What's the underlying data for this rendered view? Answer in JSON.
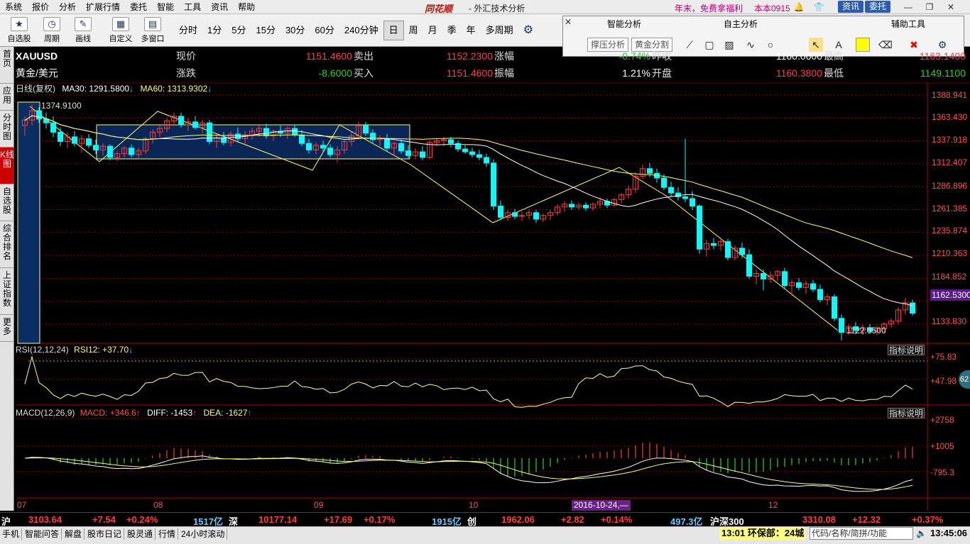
{
  "menu": {
    "items": [
      "系统",
      "报价",
      "分析",
      "扩展行情",
      "委托",
      "智能",
      "工具",
      "资讯",
      "帮助"
    ],
    "brand": "同花顺",
    "app_title": "- 外汇技术分析",
    "promo": "年末，免费拿福利",
    "version": "本本0915",
    "info_button": "资讯",
    "trade_button": "委托"
  },
  "toolbar": {
    "tools": [
      {
        "label": "自选股",
        "icon": "star-icon"
      },
      {
        "label": "周期",
        "icon": "cycle-icon"
      },
      {
        "label": "画线",
        "icon": "pen-icon"
      },
      {
        "label": "自定义",
        "icon": "custom-icon"
      },
      {
        "label": "多窗口",
        "icon": "multiwindow-icon"
      }
    ],
    "periods": [
      "分时",
      "1分",
      "5分",
      "15分",
      "30分",
      "60分",
      "240分钟",
      "日",
      "周",
      "月",
      "季",
      "年",
      "多周期"
    ],
    "active_period": "日"
  },
  "analysis_panel": {
    "smart": "智能分析",
    "self": "自主分析",
    "aux": "辅助工具",
    "btn_pressure": "撑压分析",
    "btn_golden": "黄金分割"
  },
  "vertical_tabs": [
    "首页",
    "应用",
    "分时图",
    "K线图",
    "自选股",
    "综合排名",
    "上证指数",
    "更多"
  ],
  "active_tab": "K线图",
  "quote": {
    "symbol": "XAUUSD",
    "name": "黄金/美元",
    "l_now": "现价",
    "v_now": "1151.4600",
    "l_chg": "涨跌",
    "v_chg": "-8.6000",
    "l_sell": "卖出",
    "v_sell": "1152.2300",
    "l_buy": "买入",
    "v_buy": "1151.4600",
    "l_pct": "涨幅",
    "v_pct": "-0.74%",
    "l_amp": "振幅",
    "v_amp": "1.21%",
    "l_prev": "昨收",
    "v_prev": "1160.0600",
    "l_open": "开盘",
    "v_open": "1160.3800",
    "l_high": "最高",
    "v_high": "1163.1400",
    "l_low": "最低",
    "v_low": "1149.1100"
  },
  "main_legend": {
    "label": "日线(复权)",
    "ma30": "MA30: 1291.5800",
    "ma60": "MA60: 1313.9302"
  },
  "rsi_legend": {
    "name": "RSI(12,12,24)",
    "value": "RSI12: +37.70"
  },
  "macd_legend": {
    "name": "MACD(12,26,9)",
    "macd": "MACD: +346.6",
    "diff": "DIFF: -1453",
    "dea": "DEA: -1627"
  },
  "explain_label": "指标说明",
  "right_axis": {
    "main": [
      "1388.941",
      "1363.430",
      "1337.918",
      "1312.407",
      "1286.896",
      "1261.385",
      "1235.874",
      "1210.363",
      "1184.852",
      "1159.341",
      "1133.830"
    ],
    "rsi": [
      "+75.83",
      "+47.98"
    ],
    "macd": [
      "+2758",
      "+1005",
      "-795.3"
    ],
    "current_price_tag": "1162.5300",
    "rsi_badge": "62"
  },
  "annotations": {
    "high": "1374.9100",
    "low": "1122.3500"
  },
  "date_axis": {
    "labels": [
      "07",
      "08",
      "09",
      "10",
      "12"
    ],
    "cursor_date": "2016-10-24,—"
  },
  "index_bar": {
    "sh_label": "沪",
    "sh_val": "3103.64",
    "sh_chg": "+7.54",
    "sh_pct": "+0.24%",
    "sh_amt": "1517亿",
    "sz_label": "深",
    "sz_val": "10177.14",
    "sz_chg": "+17.69",
    "sz_pct": "+0.17%",
    "sz_amt": "1915亿",
    "cy_label": "创",
    "cy_val": "1962.06",
    "cy_chg": "+2.82",
    "cy_pct": "+0.14%",
    "cy_amt": "497.3亿",
    "hs_label": "沪深300",
    "hs_val": "3310.08",
    "hs_chg": "+12.32",
    "hs_pct": "+0.37%"
  },
  "status_bar": {
    "items": [
      "手机",
      "智能问答",
      "解盘",
      "股市日记",
      "股灵通",
      "行情",
      "24小时滚动"
    ],
    "ticker": "13:01 环保部：24城",
    "search_hint": "代码/名称/简拼/功能",
    "clock": "13:45:06"
  },
  "colors": {
    "up": "#ff3b3b",
    "down": "#00ffff",
    "ma1": "#ffffff",
    "ma2": "#ffff66",
    "grid": "#8b0000"
  },
  "chart_data": {
    "type": "candlestick",
    "symbol": "XAUUSD",
    "period": "daily",
    "ylim": [
      1122.35,
      1388.941
    ],
    "ohlc": [
      [
        1352,
        1362,
        1341,
        1358
      ],
      [
        1358,
        1374.91,
        1352,
        1368
      ],
      [
        1368,
        1372,
        1355,
        1359
      ],
      [
        1359,
        1366,
        1349,
        1355
      ],
      [
        1355,
        1362,
        1340,
        1345
      ],
      [
        1345,
        1350,
        1330,
        1335
      ],
      [
        1335,
        1345,
        1328,
        1340
      ],
      [
        1340,
        1346,
        1330,
        1333
      ],
      [
        1333,
        1342,
        1323,
        1338
      ],
      [
        1338,
        1343,
        1328,
        1331
      ],
      [
        1331,
        1337,
        1322,
        1326
      ],
      [
        1326,
        1333,
        1320,
        1330
      ],
      [
        1330,
        1332,
        1315,
        1318
      ],
      [
        1318,
        1325,
        1314,
        1322
      ],
      [
        1322,
        1330,
        1318,
        1328
      ],
      [
        1328,
        1332,
        1318,
        1321
      ],
      [
        1321,
        1328,
        1316,
        1325
      ],
      [
        1325,
        1340,
        1322,
        1338
      ],
      [
        1338,
        1348,
        1333,
        1345
      ],
      [
        1345,
        1352,
        1340,
        1349
      ],
      [
        1349,
        1360,
        1345,
        1357
      ],
      [
        1357,
        1366,
        1352,
        1362
      ],
      [
        1362,
        1366,
        1350,
        1353
      ],
      [
        1353,
        1360,
        1346,
        1356
      ],
      [
        1356,
        1362,
        1348,
        1350
      ],
      [
        1350,
        1358,
        1344,
        1355
      ],
      [
        1355,
        1358,
        1332,
        1335
      ],
      [
        1335,
        1342,
        1328,
        1339
      ],
      [
        1339,
        1345,
        1331,
        1334
      ],
      [
        1334,
        1346,
        1330,
        1343
      ],
      [
        1343,
        1350,
        1335,
        1338
      ],
      [
        1338,
        1346,
        1332,
        1342
      ],
      [
        1342,
        1350,
        1337,
        1346
      ],
      [
        1346,
        1354,
        1340,
        1349
      ],
      [
        1349,
        1354,
        1338,
        1341
      ],
      [
        1341,
        1348,
        1336,
        1346
      ],
      [
        1346,
        1352,
        1340,
        1344
      ],
      [
        1344,
        1351,
        1338,
        1349
      ],
      [
        1349,
        1353,
        1340,
        1342
      ],
      [
        1342,
        1347,
        1330,
        1333
      ],
      [
        1333,
        1338,
        1322,
        1326
      ],
      [
        1326,
        1334,
        1321,
        1331
      ],
      [
        1331,
        1336,
        1324,
        1328
      ],
      [
        1328,
        1332,
        1318,
        1321
      ],
      [
        1321,
        1330,
        1313,
        1326
      ],
      [
        1326,
        1338,
        1322,
        1335
      ],
      [
        1335,
        1345,
        1330,
        1341
      ],
      [
        1341,
        1356,
        1338,
        1352
      ],
      [
        1352,
        1356,
        1341,
        1344
      ],
      [
        1344,
        1348,
        1334,
        1337
      ],
      [
        1337,
        1342,
        1330,
        1338
      ],
      [
        1338,
        1343,
        1325,
        1328
      ],
      [
        1328,
        1335,
        1320,
        1333
      ],
      [
        1333,
        1337,
        1322,
        1325
      ],
      [
        1325,
        1331,
        1317,
        1320
      ],
      [
        1320,
        1328,
        1316,
        1324
      ],
      [
        1324,
        1330,
        1315,
        1318
      ],
      [
        1318,
        1336,
        1316,
        1334
      ],
      [
        1334,
        1338,
        1330,
        1336
      ],
      [
        1336,
        1340,
        1330,
        1337
      ],
      [
        1337,
        1340,
        1329,
        1333
      ],
      [
        1333,
        1336,
        1324,
        1327
      ],
      [
        1327,
        1331,
        1322,
        1324
      ],
      [
        1324,
        1328,
        1318,
        1321
      ],
      [
        1321,
        1326,
        1315,
        1318
      ],
      [
        1318,
        1322,
        1308,
        1312
      ],
      [
        1312,
        1316,
        1262,
        1266
      ],
      [
        1266,
        1272,
        1251,
        1254
      ],
      [
        1254,
        1262,
        1250,
        1259
      ],
      [
        1259,
        1263,
        1252,
        1255
      ],
      [
        1255,
        1260,
        1250,
        1256
      ],
      [
        1256,
        1262,
        1252,
        1259
      ],
      [
        1259,
        1262,
        1248,
        1252
      ],
      [
        1252,
        1258,
        1249,
        1256
      ],
      [
        1256,
        1262,
        1251,
        1259
      ],
      [
        1259,
        1268,
        1256,
        1265
      ],
      [
        1265,
        1271,
        1260,
        1268
      ],
      [
        1268,
        1272,
        1262,
        1265
      ],
      [
        1265,
        1270,
        1262,
        1267
      ],
      [
        1267,
        1270,
        1261,
        1264
      ],
      [
        1264,
        1270,
        1261,
        1268
      ],
      [
        1268,
        1275,
        1264,
        1271
      ],
      [
        1271,
        1274,
        1264,
        1267
      ],
      [
        1267,
        1275,
        1265,
        1273
      ],
      [
        1273,
        1280,
        1269,
        1278
      ],
      [
        1278,
        1288,
        1274,
        1284
      ],
      [
        1284,
        1302,
        1280,
        1298
      ],
      [
        1298,
        1310,
        1295,
        1306
      ],
      [
        1306,
        1312,
        1297,
        1301
      ],
      [
        1301,
        1306,
        1291,
        1296
      ],
      [
        1296,
        1300,
        1283,
        1286
      ],
      [
        1286,
        1292,
        1276,
        1280
      ],
      [
        1280,
        1286,
        1272,
        1276
      ],
      [
        1276,
        1338,
        1270,
        1274
      ],
      [
        1274,
        1282,
        1262,
        1266
      ],
      [
        1266,
        1268,
        1215,
        1220
      ],
      [
        1220,
        1230,
        1212,
        1226
      ],
      [
        1226,
        1232,
        1220,
        1224
      ],
      [
        1224,
        1230,
        1218,
        1228
      ],
      [
        1228,
        1231,
        1208,
        1211
      ],
      [
        1211,
        1224,
        1208,
        1221
      ],
      [
        1221,
        1227,
        1210,
        1214
      ],
      [
        1214,
        1220,
        1188,
        1191
      ],
      [
        1191,
        1198,
        1182,
        1194
      ],
      [
        1194,
        1198,
        1176,
        1188
      ],
      [
        1188,
        1196,
        1184,
        1192
      ],
      [
        1192,
        1198,
        1186,
        1196
      ],
      [
        1196,
        1200,
        1178,
        1181
      ],
      [
        1181,
        1187,
        1170,
        1184
      ],
      [
        1184,
        1189,
        1176,
        1179
      ],
      [
        1179,
        1186,
        1172,
        1183
      ],
      [
        1183,
        1187,
        1174,
        1177
      ],
      [
        1177,
        1182,
        1163,
        1166
      ],
      [
        1166,
        1172,
        1160,
        1169
      ],
      [
        1169,
        1172,
        1143,
        1146
      ],
      [
        1146,
        1150,
        1122.35,
        1131
      ],
      [
        1131,
        1140,
        1128,
        1137
      ],
      [
        1137,
        1142,
        1129,
        1133
      ],
      [
        1133,
        1139,
        1128,
        1136
      ],
      [
        1136,
        1140,
        1130,
        1132
      ],
      [
        1132,
        1138,
        1128,
        1135
      ],
      [
        1135,
        1142,
        1131,
        1140
      ],
      [
        1140,
        1146,
        1136,
        1143
      ],
      [
        1143,
        1158,
        1140,
        1155
      ],
      [
        1155,
        1168,
        1150,
        1162.53
      ],
      [
        1162.53,
        1166,
        1149.11,
        1151.46
      ]
    ],
    "ma_series": [
      {
        "name": "MA30",
        "last": 1291.58
      },
      {
        "name": "MA60",
        "last": 1313.9302
      }
    ],
    "annotations": [
      {
        "label": "1374.9100",
        "kind": "high"
      },
      {
        "label": "1122.3500",
        "kind": "low"
      }
    ],
    "x_labels": [
      "07",
      "08",
      "09",
      "10",
      "12"
    ],
    "rsi": {
      "ylim": [
        0,
        100
      ],
      "levels": [
        75.83,
        47.98
      ],
      "last": 37.7
    },
    "macd": {
      "ylim": [
        -2500,
        3000
      ],
      "levels": [
        2758,
        1005,
        -795.3
      ],
      "macd": 346.6,
      "diff": -1453,
      "dea": -1627
    }
  }
}
